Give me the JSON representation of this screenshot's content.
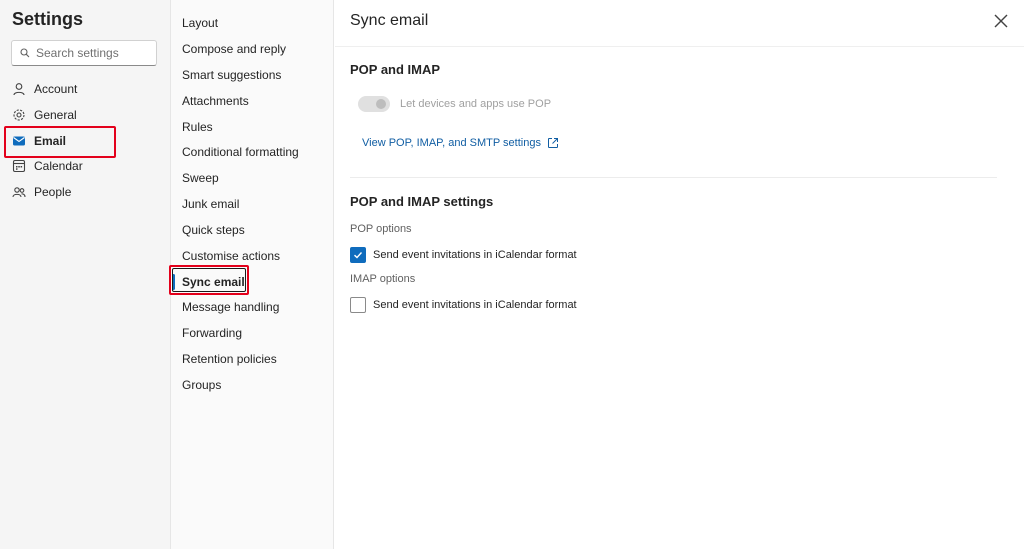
{
  "settings": {
    "title": "Settings",
    "search_placeholder": "Search settings"
  },
  "nav": {
    "items": [
      {
        "label": "Account",
        "icon": "person-icon"
      },
      {
        "label": "General",
        "icon": "gear-icon"
      },
      {
        "label": "Email",
        "icon": "mail-icon",
        "active": true
      },
      {
        "label": "Calendar",
        "icon": "calendar-icon"
      },
      {
        "label": "People",
        "icon": "people-icon"
      }
    ]
  },
  "subnav": {
    "items": [
      {
        "label": "Layout"
      },
      {
        "label": "Compose and reply"
      },
      {
        "label": "Smart suggestions"
      },
      {
        "label": "Attachments"
      },
      {
        "label": "Rules"
      },
      {
        "label": "Conditional formatting"
      },
      {
        "label": "Sweep"
      },
      {
        "label": "Junk email"
      },
      {
        "label": "Quick steps"
      },
      {
        "label": "Customise actions"
      },
      {
        "label": "Sync email",
        "active": true
      },
      {
        "label": "Message handling"
      },
      {
        "label": "Forwarding"
      },
      {
        "label": "Retention policies"
      },
      {
        "label": "Groups"
      }
    ]
  },
  "panel": {
    "title": "Sync email",
    "section1": {
      "heading": "POP and IMAP",
      "toggle_label": "Let devices and apps use POP",
      "link_label": "View POP, IMAP, and SMTP settings"
    },
    "section2": {
      "heading": "POP and IMAP settings",
      "pop_label": "POP options",
      "pop_checkbox": {
        "label": "Send event invitations in iCalendar format",
        "checked": true
      },
      "imap_label": "IMAP options",
      "imap_checkbox": {
        "label": "Send event invitations in iCalendar format",
        "checked": false
      }
    }
  },
  "colors": {
    "accent": "#0f6cbd",
    "highlight": "#e3001b",
    "link": "#115ea3"
  }
}
